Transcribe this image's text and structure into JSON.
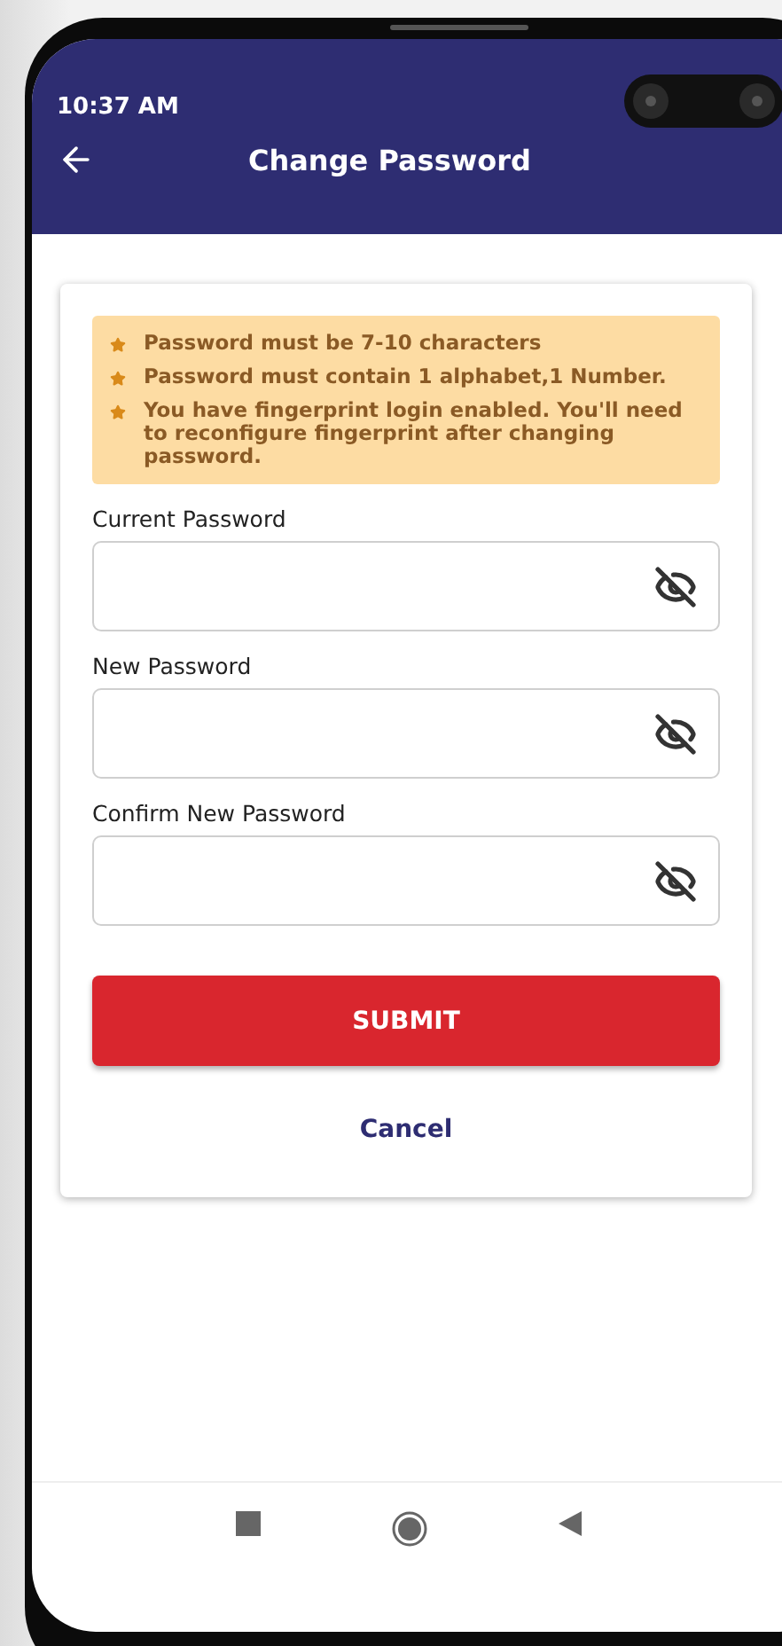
{
  "status_bar": {
    "time": "10:37 AM"
  },
  "header": {
    "title": "Change Password"
  },
  "notices": [
    "Password must be 7-10 characters",
    " Password must contain 1 alphabet,1 Number.",
    "You have fingerprint login enabled. You'll need to reconfigure fingerprint after changing password."
  ],
  "fields": [
    {
      "label": "Current Password",
      "visible": false
    },
    {
      "label": "New Password",
      "visible": false
    },
    {
      "label": "Confirm New Password",
      "visible": false
    }
  ],
  "buttons": {
    "submit": "SUBMIT",
    "cancel": "Cancel"
  }
}
